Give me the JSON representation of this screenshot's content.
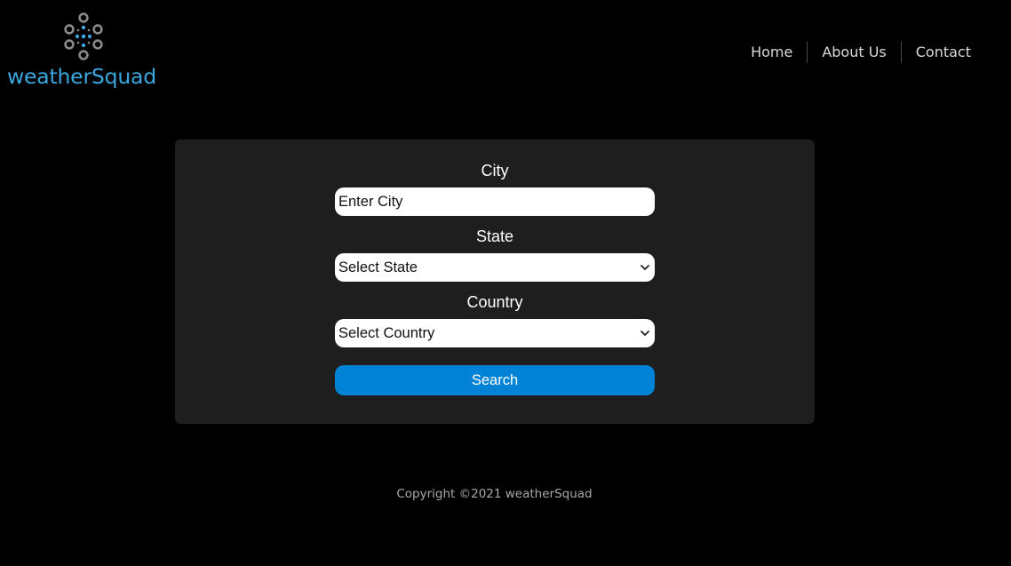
{
  "brand": {
    "name": "weatherSquad",
    "color": "#3aa7df",
    "icon": "weather-dots-logo-icon"
  },
  "nav": {
    "items": [
      {
        "label": "Home"
      },
      {
        "label": "About Us"
      },
      {
        "label": "Contact"
      }
    ]
  },
  "form": {
    "city": {
      "label": "City",
      "placeholder": "Enter City",
      "value": ""
    },
    "state": {
      "label": "State",
      "selected": "Select State"
    },
    "country": {
      "label": "Country",
      "selected": "Select Country"
    },
    "search_label": "Search",
    "accent": "#0083d6"
  },
  "footer": {
    "text": "Copyright ©2021 weatherSquad"
  }
}
